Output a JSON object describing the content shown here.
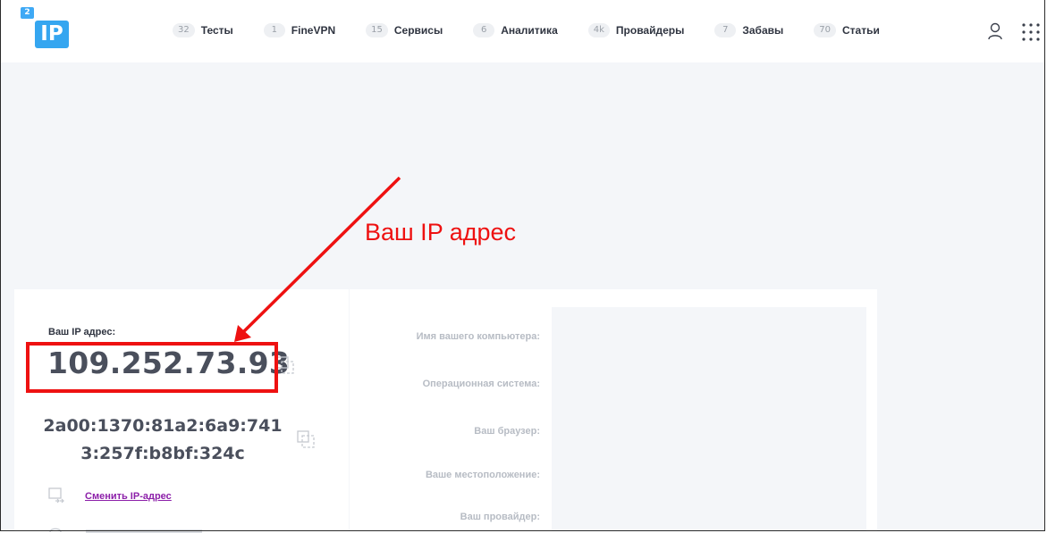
{
  "logo": {
    "small_text": "2",
    "main_text": "IP"
  },
  "nav": [
    {
      "count": "32",
      "label": "Тесты"
    },
    {
      "count": "1",
      "label": "FineVPN"
    },
    {
      "count": "15",
      "label": "Сервисы"
    },
    {
      "count": "6",
      "label": "Аналитика"
    },
    {
      "count": "4k",
      "label": "Провайдеры"
    },
    {
      "count": "7",
      "label": "Забавы"
    },
    {
      "count": "70",
      "label": "Статьи"
    }
  ],
  "header_icons": {
    "user": "user-icon",
    "apps": "apps-grid-icon"
  },
  "ip_panel": {
    "label": "Ваш IP адрес:",
    "ipv4": "109.252.73.93",
    "ipv6_line1": "2a00:1370:81a2:6a9:741",
    "ipv6_line2": "3:257f:b8bf:324c",
    "change_link": "Сменить IP-адрес"
  },
  "info_labels": [
    "Имя вашего компьютера:",
    "Операционная система:",
    "Ваш браузер:",
    "Ваше местоположение:",
    "Ваш провайдер:"
  ],
  "annotation": {
    "text": "Ваш IP адрес",
    "color": "#ee1111"
  },
  "colors": {
    "accent_blue": "#35a6f0",
    "link_purple": "#8c1fa9",
    "background_gray": "#f4f6f9"
  }
}
